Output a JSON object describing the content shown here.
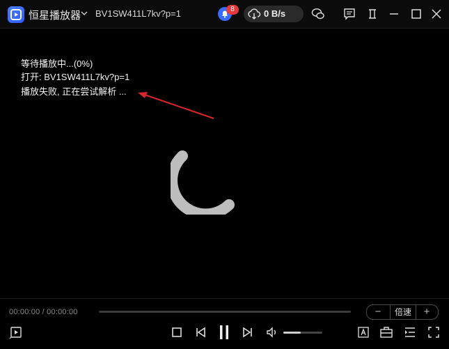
{
  "app": {
    "title": "恒星播放器",
    "video_title": "BV1SW411L7kv?p=1",
    "notification_count": "8",
    "download_speed": "0 B/s"
  },
  "status": {
    "line1": "等待播放中...(0%)",
    "line2": "打开: BV1SW411L7kv?p=1",
    "line3": "播放失败, 正在尝试解析 ..."
  },
  "player": {
    "time": "00:00:00 / 00:00:00",
    "progress": 0,
    "volume": 0.45,
    "speed_minus": "−",
    "speed_label": "倍速",
    "speed_plus": "+"
  },
  "colors": {
    "accent": "#3a6bff",
    "badge": "#e23b3b",
    "annotation_arrow": "#d9262c"
  },
  "icons": {
    "titlebar": [
      "app-logo-icon",
      "chevron-down-icon",
      "notification-bell-icon",
      "cloud-download-icon",
      "wechat-icon",
      "message-icon",
      "pin-window-icon",
      "minimize-icon",
      "maximize-icon",
      "close-icon"
    ],
    "controls": [
      "playlist-icon",
      "stop-icon",
      "previous-icon",
      "pause-icon",
      "next-icon",
      "volume-icon",
      "subtitle-icon",
      "toolbox-icon",
      "list-toggle-icon",
      "fullscreen-icon"
    ]
  }
}
